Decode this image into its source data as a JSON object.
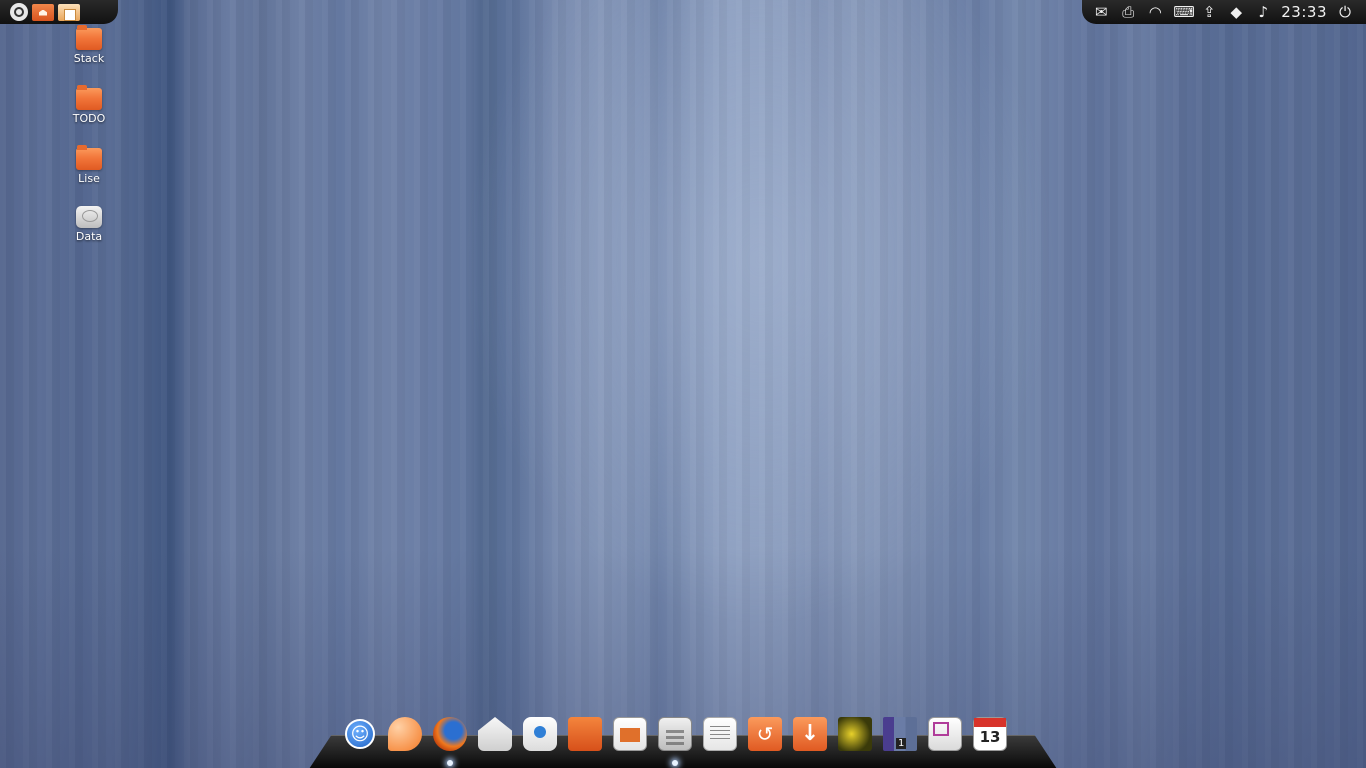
{
  "top_panel_left": {
    "icons": [
      "ubuntu-logo-icon",
      "home-folder-icon",
      "documents-folder-icon"
    ]
  },
  "top_panel_right": {
    "tray_icons": [
      "mail-icon",
      "printer-icon",
      "wifi-icon",
      "keyboard-icon",
      "upload-icon",
      "dropbox-icon",
      "volume-icon"
    ],
    "clock": "23:33",
    "power_icon": "power-icon"
  },
  "desktop_icons": [
    {
      "label": "Stack",
      "type": "folder"
    },
    {
      "label": "TODO",
      "type": "folder"
    },
    {
      "label": "Lise",
      "type": "folder"
    },
    {
      "label": "Data",
      "type": "drive"
    }
  ],
  "dock": {
    "calendar_day": "13",
    "items": [
      {
        "icon": "accessibility-icon",
        "running": false
      },
      {
        "icon": "clementine-icon",
        "running": false
      },
      {
        "icon": "firefox-icon",
        "running": true
      },
      {
        "icon": "mail-client-icon",
        "running": false
      },
      {
        "icon": "chat-icon",
        "running": false
      },
      {
        "icon": "software-center-icon",
        "running": false
      },
      {
        "icon": "presentation-icon",
        "running": false
      },
      {
        "icon": "calculator-icon",
        "running": true
      },
      {
        "icon": "text-editor-icon",
        "running": false
      },
      {
        "icon": "backup-icon",
        "running": false
      },
      {
        "icon": "downloads-icon",
        "running": false
      },
      {
        "icon": "photo-viewer-icon",
        "running": false
      },
      {
        "icon": "workspaces-icon",
        "running": false
      },
      {
        "icon": "window-icon",
        "running": false
      },
      {
        "icon": "calendar-icon",
        "running": false
      }
    ]
  }
}
